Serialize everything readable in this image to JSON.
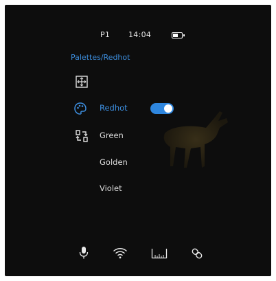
{
  "status_bar": {
    "profile": "P1",
    "time": "14:04",
    "battery_level": 0.7
  },
  "breadcrumb": "Palettes/Redhot",
  "menu": {
    "items": [
      {
        "label": "Redhot",
        "active": true,
        "toggle_on": true,
        "icon": "palette-icon"
      },
      {
        "label": "Green",
        "active": false,
        "icon": "swap-icon"
      },
      {
        "label": "Golden",
        "active": false
      },
      {
        "label": "Violet",
        "active": false
      }
    ]
  },
  "colors": {
    "accent": "#3d8fe0",
    "toggle": "#2e86de",
    "background": "#0d0d0d",
    "text": "#dcdcdc"
  },
  "bottom_bar": {
    "icons": [
      "microphone-icon",
      "wifi-icon",
      "ruler-icon",
      "link-icon"
    ]
  }
}
